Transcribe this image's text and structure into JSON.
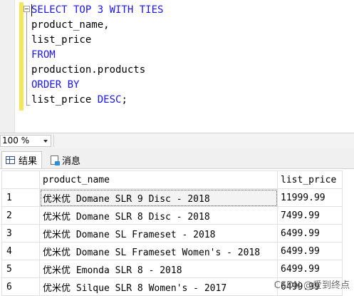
{
  "editor": {
    "lines": [
      [
        {
          "t": "SELECT TOP 3 WITH TIES",
          "k": true
        }
      ],
      [
        {
          "t": "product_name,",
          "k": false
        }
      ],
      [
        {
          "t": "list_price",
          "k": false
        }
      ],
      [
        {
          "t": "FROM",
          "k": true
        }
      ],
      [
        {
          "t": "production.products",
          "k": false
        }
      ],
      [
        {
          "t": "ORDER BY",
          "k": true
        }
      ],
      [
        {
          "t": "list_price ",
          "k": false
        },
        {
          "t": "DESC",
          "k": true
        },
        {
          "t": ";",
          "k": false
        }
      ]
    ]
  },
  "zoom": {
    "value": "100 %"
  },
  "tabs": {
    "results": "结果",
    "messages": "消息"
  },
  "grid": {
    "headers": [
      "product_name",
      "list_price"
    ],
    "rows": [
      {
        "n": "1",
        "name": "优米优 Domane SLR 9 Disc - 2018",
        "price": "11999.99"
      },
      {
        "n": "2",
        "name": "优米优 Domane SLR 8 Disc - 2018",
        "price": "7499.99"
      },
      {
        "n": "3",
        "name": "优米优 Domane SL Frameset - 2018",
        "price": "6499.99"
      },
      {
        "n": "4",
        "name": "优米优 Domane SL Frameset Women's - 2018",
        "price": "6499.99"
      },
      {
        "n": "5",
        "name": "优米优 Emonda SLR 8 - 2018",
        "price": "6499.99"
      },
      {
        "n": "6",
        "name": "优米优 Silque SLR 8 Women's - 2017",
        "price": "6499.99"
      }
    ]
  },
  "watermark": "CSDN @爱到终点"
}
